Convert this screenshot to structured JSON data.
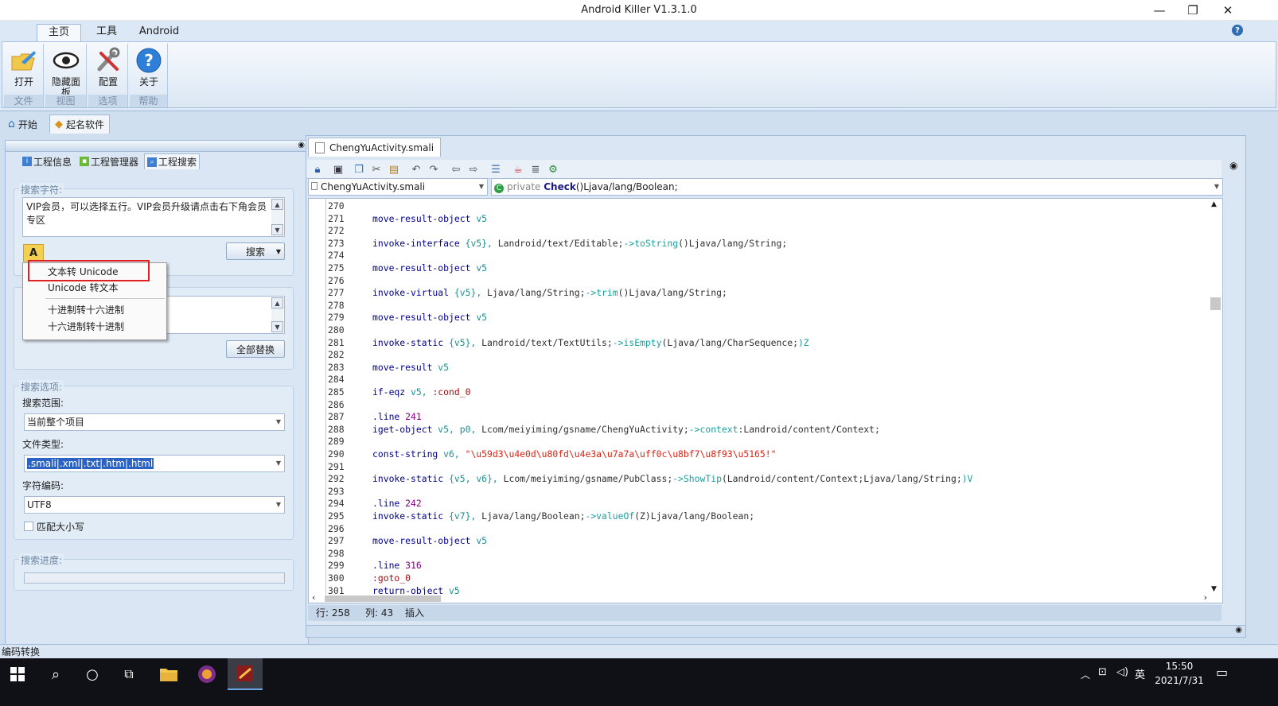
{
  "window": {
    "title": "Android Killer V1.3.1.0",
    "minimize": "—",
    "restore": "❐",
    "close": "✕"
  },
  "ribbon": {
    "tabs": [
      "主页",
      "工具",
      "Android"
    ],
    "help_icon": "?",
    "groups": [
      {
        "caption": "文件",
        "buttons": [
          {
            "label": "打开",
            "icon": "folder-icon"
          }
        ]
      },
      {
        "caption": "视图",
        "buttons": [
          {
            "label": "隐藏面板",
            "icon": "eye-icon"
          }
        ]
      },
      {
        "caption": "选项",
        "buttons": [
          {
            "label": "配置",
            "icon": "tools-icon"
          }
        ]
      },
      {
        "caption": "帮助",
        "buttons": [
          {
            "label": "关于",
            "icon": "help-icon"
          }
        ]
      }
    ]
  },
  "doc_tabs": [
    {
      "label": "开始",
      "icon": "home-icon"
    },
    {
      "label": "起名软件",
      "icon": "project-icon"
    }
  ],
  "left_panel": {
    "subtabs": [
      "工程信息",
      "工程管理器",
      "工程搜索"
    ],
    "search_label": "搜索字符:",
    "search_text": "VIP会员，可以选择五行。VIP会员升级请点击右下角会员专区",
    "search_button": "搜索",
    "replace_all_button": "全部替换",
    "options_caption": "搜索选项:",
    "scope_label": "搜索范围:",
    "scope_value": "当前整个项目",
    "filetype_label": "文件类型:",
    "filetype_value": ".smali|.xml|.txt|.htm|.html",
    "encoding_label": "字符编码:",
    "encoding_value": "UTF8",
    "match_case_label": "匹配大小写",
    "progress_caption": "搜索进度:",
    "progress": 0
  },
  "context_menu": {
    "items": [
      "文本转 Unicode",
      "Unicode 转文本",
      "十进制转十六进制",
      "十六进制转十进制"
    ],
    "highlighted": "文本转 Unicode"
  },
  "editor": {
    "tab": "ChengYuActivity.smali",
    "file_combo": "ChengYuActivity.smali",
    "method_prefix": "private ",
    "method_name": "Check",
    "method_suffix": "()Ljava/lang/Boolean;",
    "lines": [
      {
        "n": "270",
        "t": ""
      },
      {
        "n": "271",
        "t": "move-result-object v5"
      },
      {
        "n": "272",
        "t": ""
      },
      {
        "n": "273",
        "t": "invoke-interface {v5}, Landroid/text/Editable;->toString()Ljava/lang/String;"
      },
      {
        "n": "274",
        "t": ""
      },
      {
        "n": "275",
        "t": "move-result-object v5"
      },
      {
        "n": "276",
        "t": ""
      },
      {
        "n": "277",
        "t": "invoke-virtual {v5}, Ljava/lang/String;->trim()Ljava/lang/String;"
      },
      {
        "n": "278",
        "t": ""
      },
      {
        "n": "279",
        "t": "move-result-object v5"
      },
      {
        "n": "280",
        "t": ""
      },
      {
        "n": "281",
        "t": "invoke-static {v5}, Landroid/text/TextUtils;->isEmpty(Ljava/lang/CharSequence;)Z"
      },
      {
        "n": "282",
        "t": ""
      },
      {
        "n": "283",
        "t": "move-result v5"
      },
      {
        "n": "284",
        "t": ""
      },
      {
        "n": "285",
        "t": "if-eqz v5, :cond_0"
      },
      {
        "n": "286",
        "t": ""
      },
      {
        "n": "287",
        "t": ".line 241"
      },
      {
        "n": "288",
        "t": "iget-object v5, p0, Lcom/meiyiming/gsname/ChengYuActivity;->context:Landroid/content/Context;"
      },
      {
        "n": "289",
        "t": ""
      },
      {
        "n": "290",
        "t": "const-string v6, \"\\u59d3\\u4e0d\\u80fd\\u4e3a\\u7a7a\\uff0c\\u8bf7\\u8f93\\u5165!\""
      },
      {
        "n": "291",
        "t": ""
      },
      {
        "n": "292",
        "t": "invoke-static {v5, v6}, Lcom/meiyiming/gsname/PubClass;->ShowTip(Landroid/content/Context;Ljava/lang/String;)V"
      },
      {
        "n": "293",
        "t": ""
      },
      {
        "n": "294",
        "t": ".line 242"
      },
      {
        "n": "295",
        "t": "invoke-static {v7}, Ljava/lang/Boolean;->valueOf(Z)Ljava/lang/Boolean;"
      },
      {
        "n": "296",
        "t": ""
      },
      {
        "n": "297",
        "t": "move-result-object v5"
      },
      {
        "n": "298",
        "t": ""
      },
      {
        "n": "299",
        "t": ".line 316"
      },
      {
        "n": "300",
        "t": ":goto_0"
      },
      {
        "n": "301",
        "t": "return-object v5"
      }
    ],
    "status_row": "行: 258",
    "status_col": "列: 43",
    "status_mode": "插入"
  },
  "status_bar": {
    "text": "编码转换"
  },
  "taskbar": {
    "time": "15:50",
    "date": "2021/7/31",
    "ime": "英"
  }
}
